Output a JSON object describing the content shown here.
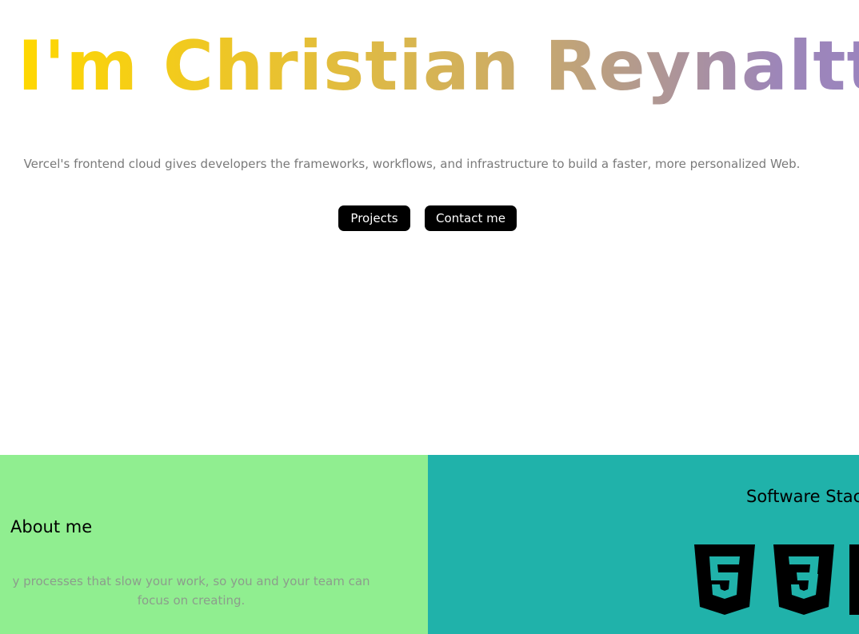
{
  "hero": {
    "title": "I'm Christian Reynaltt",
    "subtitle": "Vercel's frontend cloud gives developers the frameworks, workflows, and infrastructure to build a faster, more personalized Web.",
    "buttons": {
      "projects_label": "Projects",
      "contact_label": "Contact me"
    }
  },
  "about": {
    "title": "About me",
    "text": "y processes that slow your work, so you and your team can focus on creating."
  },
  "stack": {
    "title": "Software Stack",
    "icons": [
      "html5-icon",
      "css3-icon"
    ]
  },
  "colors": {
    "about_bg": "#90ee90",
    "stack_bg": "#20b2aa",
    "button_bg": "#000000",
    "title_gradient": [
      "#ffd800",
      "#e9c230",
      "#cfae62",
      "#b39a8e",
      "#9a84bf"
    ]
  }
}
